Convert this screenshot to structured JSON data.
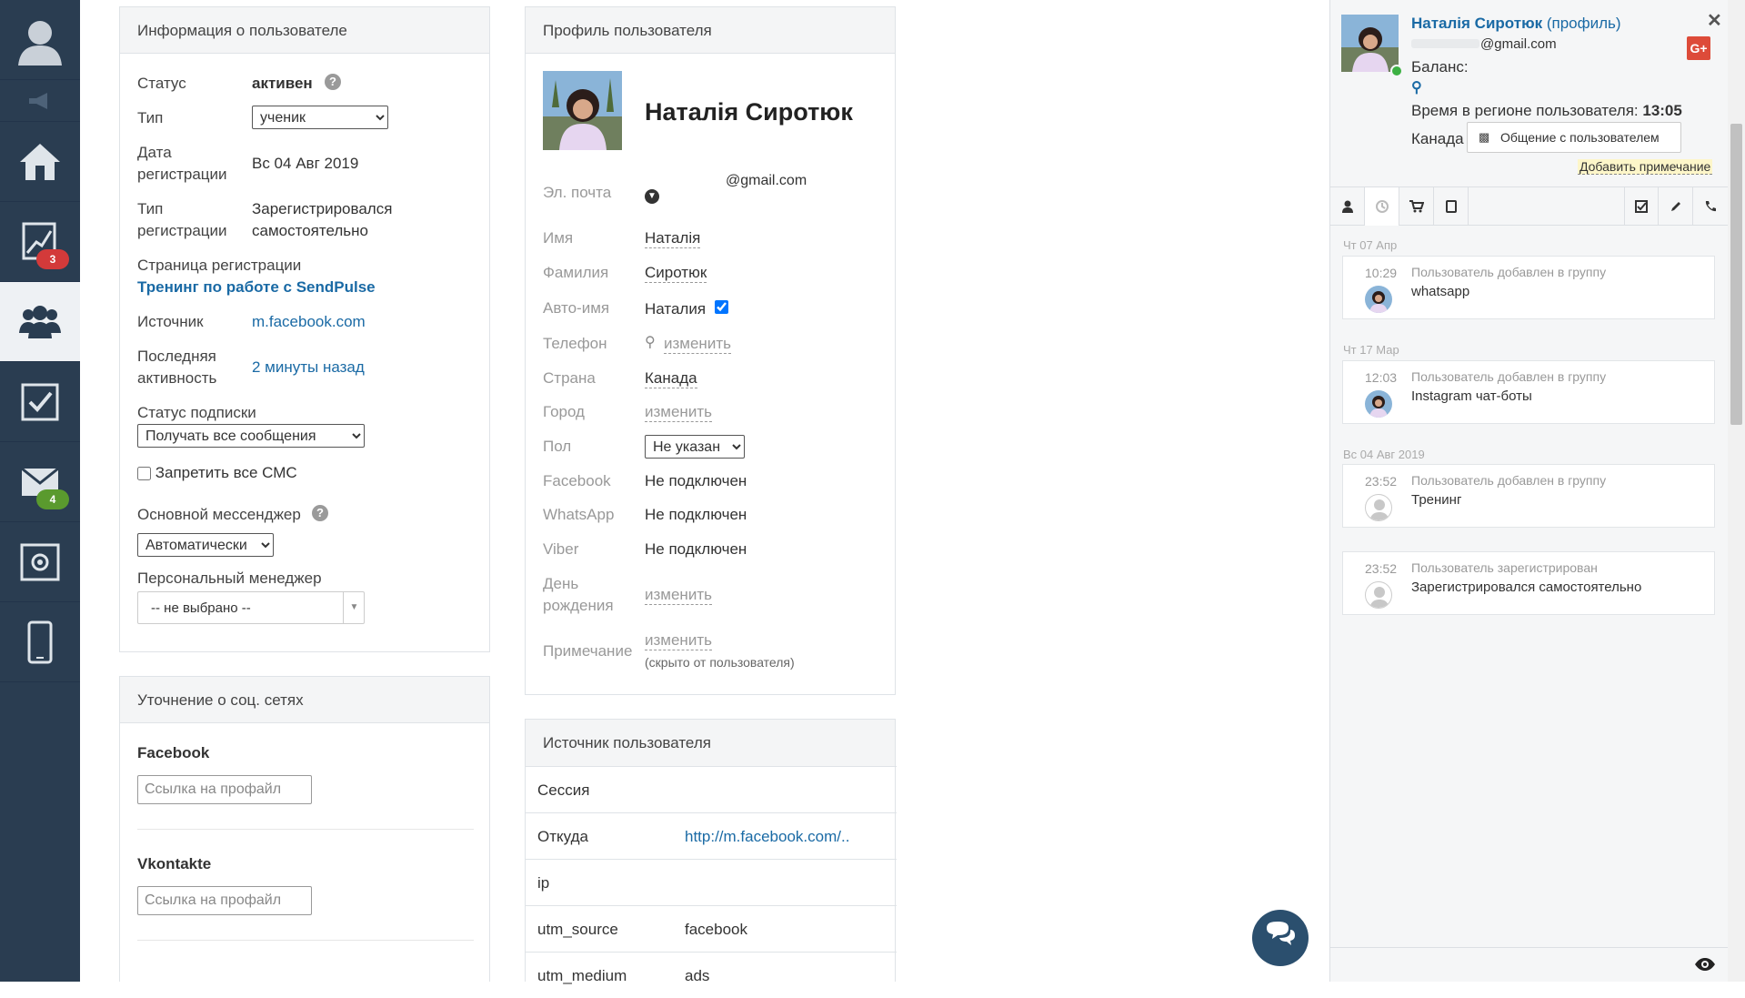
{
  "colors": {
    "nav_bg": "#2a3d51",
    "link": "#1a6aa5",
    "badge_red": "#d33a3a",
    "badge_green": "#5a9a2e",
    "google": "#dd4b39",
    "online": "#3cb043"
  },
  "nav": {
    "items": [
      {
        "icon": "avatar-icon"
      },
      {
        "icon": "megaphone-icon"
      },
      {
        "icon": "home-icon"
      },
      {
        "icon": "chart-icon",
        "badge": "3"
      },
      {
        "icon": "users-icon",
        "active": true
      },
      {
        "icon": "tasks-icon"
      },
      {
        "icon": "mail-icon",
        "badge": "4"
      },
      {
        "icon": "settings-icon"
      },
      {
        "icon": "mobile-icon"
      }
    ]
  },
  "user_info": {
    "title": "Информация о пользователе",
    "status_label": "Статус",
    "status_value": "активен",
    "type_label": "Тип",
    "type_value": "ученик",
    "reg_date_label_1": "Дата",
    "reg_date_label_2": "регистрации",
    "reg_date_value": "Вс 04 Авг 2019",
    "reg_type_label_1": "Тип",
    "reg_type_label_2": "регистрации",
    "reg_type_value_1": "Зарегистрировался",
    "reg_type_value_2": "самостоятельно",
    "reg_page_label": "Страница регистрации",
    "reg_page_value": "Тренинг по работе с SendPulse",
    "source_label": "Источник",
    "source_value": "m.facebook.com",
    "last_activity_label_1": "Последняя",
    "last_activity_label_2": "активность",
    "last_activity_value": "2 минуты назад",
    "sub_status_label": "Статус подписки",
    "sub_status_value": "Получать все сообщения",
    "block_sms_label": "Запретить все СМС",
    "main_messenger_label": "Основной мессенджер",
    "main_messenger_value": "Автоматически",
    "manager_label": "Персональный менеджер",
    "manager_value": "-- не выбрано --"
  },
  "social": {
    "title": "Уточнение о соц. сетях",
    "facebook_label": "Facebook",
    "facebook_placeholder": "Ссылка на профайл",
    "vk_label": "Vkontakte",
    "vk_placeholder": "Ссылка на профайл"
  },
  "profile": {
    "title": "Профиль пользователя",
    "name": "Наталія Сиротюк",
    "email_label": "Эл. почта",
    "email_value": "@gmail.com",
    "first_name_label": "Имя",
    "first_name_value": "Наталія",
    "last_name_label": "Фамилия",
    "last_name_value": "Сиротюк",
    "auto_name_label": "Авто-имя",
    "auto_name_value": "Наталия",
    "phone_label": "Телефон",
    "phone_value": "изменить",
    "country_label": "Страна",
    "country_value": "Канада",
    "city_label": "Город",
    "city_value": "изменить",
    "gender_label": "Пол",
    "gender_value": "Не указан",
    "facebook_label": "Facebook",
    "facebook_value": "Не подключен",
    "whatsapp_label": "WhatsApp",
    "whatsapp_value": "Не подключен",
    "viber_label": "Viber",
    "viber_value": "Не подключен",
    "birthday_label_1": "День",
    "birthday_label_2": "рождения",
    "birthday_value": "изменить",
    "note_label": "Примечание",
    "note_value": "изменить",
    "note_hint": "(скрыто от пользователя)"
  },
  "source": {
    "title": "Источник пользователя",
    "rows": [
      {
        "label": "Сессия",
        "value": "",
        "link": false
      },
      {
        "label": "Откуда",
        "value": "http://m.facebook.com/..",
        "link": true
      },
      {
        "label": "ip",
        "value": "",
        "link": false
      },
      {
        "label": "utm_source",
        "value": "facebook",
        "link": false
      },
      {
        "label": "utm_medium",
        "value": "ads",
        "link": false
      }
    ]
  },
  "side": {
    "user_name": "Наталія Сиротюк",
    "profile_link": "(профиль)",
    "email": "@gmail.com",
    "balance_label": "Баланс:",
    "time_label": "Время в регионе пользователя:",
    "time_value": "13:05",
    "country": "Канада",
    "chat_button": "Общение с пользователем",
    "add_note": "Добавить примечание",
    "tabs": [
      "user-tab-icon",
      "history-tab-icon",
      "cart-tab-icon",
      "device-tab-icon",
      "task-tab-icon",
      "edit-tab-icon",
      "phone-tab-icon"
    ],
    "timeline": [
      {
        "date": "Чт 07 Апр",
        "time": "10:29",
        "title": "Пользователь добавлен в группу",
        "text": "whatsapp",
        "avatar": "photo"
      },
      {
        "date": "Чт 17 Мар",
        "time": "12:03",
        "title": "Пользователь добавлен в группу",
        "text": "Instagram чат-боты",
        "avatar": "photo"
      },
      {
        "date": "Вс 04 Авг 2019",
        "time": "23:52",
        "title": "Пользователь добавлен в группу",
        "text": "Тренинг",
        "avatar": "default"
      },
      {
        "date": "",
        "time": "23:52",
        "title": "Пользователь зарегистрирован",
        "text": "Зарегистрировался самостоятельно",
        "avatar": "default"
      }
    ]
  }
}
